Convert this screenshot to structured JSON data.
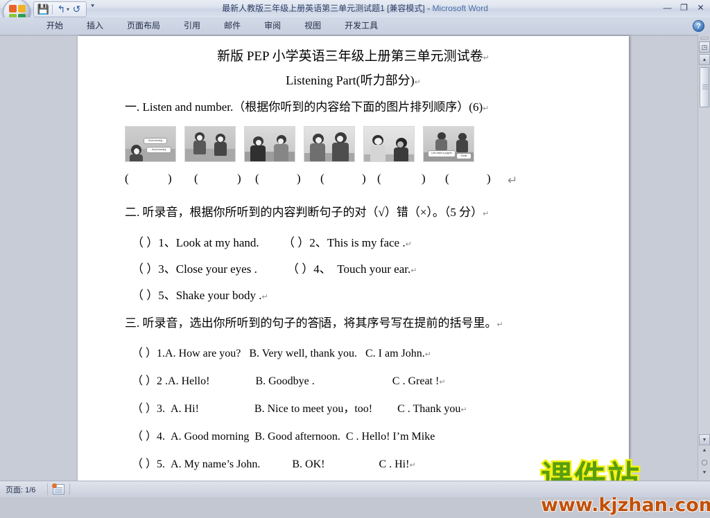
{
  "window": {
    "title": "最新人教版三年级上册英语第三单元测试题1 [兼容模式]",
    "title_separator": " - ",
    "app_name": "Microsoft Word",
    "minimize_label": "—",
    "restore_label": "❐",
    "close_label": "✕",
    "help_label": "?"
  },
  "quick_access": {
    "save_label": "💾",
    "undo_label": "↰",
    "undo_caret": "▾",
    "redo_label": "↺",
    "customize_label": "⯆"
  },
  "ribbon": {
    "tabs": [
      {
        "label": "开始"
      },
      {
        "label": "插入"
      },
      {
        "label": "页面布局"
      },
      {
        "label": "引用"
      },
      {
        "label": "邮件"
      },
      {
        "label": "审阅"
      },
      {
        "label": "视图"
      },
      {
        "label": "开发工具"
      }
    ]
  },
  "scrollbar": {
    "split_label": "",
    "select_browse_label": "◳",
    "up_label": "▲",
    "down_label": "▼",
    "prev_page_label": "⯅",
    "circle_label": "◯",
    "next_page_label": "⯆"
  },
  "document": {
    "title": "新版 PEP 小学英语三年级上册第三单元测试卷",
    "subtitle": "Listening Part(听力部分)",
    "pilcrow": "↵",
    "section_one": {
      "heading": "一. Listen and number.（根据你听到的内容给下面的图片排列顺序）(6)",
      "pictures": [
        {
          "caption_a": "Good morning",
          "caption_b": "Good morning",
          "alt": "two-children-greeting-good-morning"
        },
        {
          "caption_a": "",
          "caption_b": "",
          "alt": "two-children-walking"
        },
        {
          "caption_a": "",
          "caption_b": "",
          "alt": "two-children-high-five"
        },
        {
          "caption_a": "",
          "caption_b": "",
          "alt": "boy-and-girl-talking"
        },
        {
          "caption_a": "",
          "caption_b": "",
          "alt": "boy-waving-to-friend"
        },
        {
          "caption_a": "Let's make a puppet!",
          "caption_b": "Great!",
          "alt": "children-making-puppet"
        }
      ],
      "paren_open": "(",
      "paren_close": ")",
      "paren_count": 6
    },
    "section_two": {
      "heading": "二. 听录音，根据你所听到的内容判断句子的对（√）错（×）。（5 分）",
      "items": [
        {
          "marker": "（  ）",
          "number": "1、",
          "text": "Look at my hand."
        },
        {
          "marker": "（  ）",
          "number": "2、",
          "text": "This is my face ."
        },
        {
          "marker": "（  ）",
          "number": "3、",
          "text": "Close your eyes ."
        },
        {
          "marker": "（  ）",
          "number": "4、",
          "text": "Touch your ear."
        },
        {
          "marker": "（  ）",
          "number": "5、",
          "text": "Shake your body ."
        }
      ]
    },
    "section_three": {
      "heading_before_caret": "三.   听录音，选出你所听到的句子的答",
      "heading_after_caret": "语，将其序号写在提前的括号里。",
      "items": [
        {
          "marker": "（   ）",
          "number": "1.",
          "option_a": "A. How are you?",
          "option_b": "B. Very well, thank you.",
          "option_c": "C. I am John."
        },
        {
          "marker": "（   ）",
          "number": "2 .",
          "option_a": "A. Hello!",
          "option_b": "B. Goodbye .",
          "option_c": "C . Great !"
        },
        {
          "marker": "（   ）",
          "number": "3.",
          "option_a": "A. Hi!",
          "option_b": "B. Nice to meet you，too!",
          "option_c": "C . Thank you"
        },
        {
          "marker": "（   ）",
          "number": "4.",
          "option_a": "A. Good morning",
          "option_b": "B. Good afternoon.",
          "option_c": "C . Hello! I’m Mike"
        },
        {
          "marker": "（   ）",
          "number": "5.",
          "option_a": "A. My name’s John.",
          "option_b": "B. OK!",
          "option_c": "C . Hi!"
        }
      ]
    }
  },
  "watermark": {
    "text_cn": "课件站",
    "text_url": "www.kjzhan.com",
    "color_cn": "#5a9e0f",
    "color_outline": "#f2f211",
    "color_url": "#c1500a"
  },
  "statusbar": {
    "page_label": "页面: 1/6"
  }
}
